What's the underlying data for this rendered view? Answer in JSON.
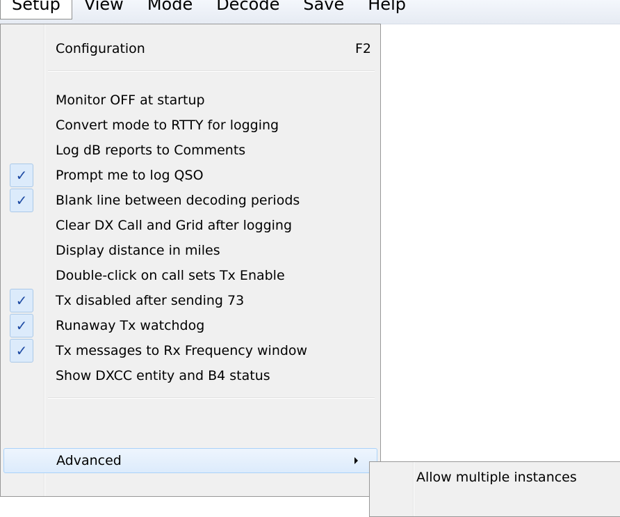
{
  "menubar": {
    "items": [
      "Setup",
      "View",
      "Mode",
      "Decode",
      "Save",
      "Help"
    ],
    "active": "Setup"
  },
  "setup_menu": {
    "configuration": {
      "label": "Configuration",
      "shortcut": "F2"
    },
    "items": [
      {
        "label": "Monitor OFF at startup",
        "checked": false
      },
      {
        "label": "Convert mode to RTTY for logging",
        "checked": false
      },
      {
        "label": "Log dB reports to Comments",
        "checked": false
      },
      {
        "label": "Prompt me to log QSO",
        "checked": true
      },
      {
        "label": "Blank line between decoding periods",
        "checked": true
      },
      {
        "label": "Clear DX Call and Grid after logging",
        "checked": false
      },
      {
        "label": "Display distance in miles",
        "checked": false
      },
      {
        "label": "Double-click on call sets Tx Enable",
        "checked": false
      },
      {
        "label": "Tx disabled after sending 73",
        "checked": true
      },
      {
        "label": "Runaway Tx watchdog",
        "checked": true
      },
      {
        "label": "Tx messages to Rx Frequency window",
        "checked": true
      },
      {
        "label": "Show DXCC entity and B4 status",
        "checked": false
      }
    ],
    "advanced": {
      "label": "Advanced",
      "has_submenu": true,
      "highlighted": true
    }
  },
  "advanced_submenu": {
    "items": [
      {
        "label": "Allow multiple instances"
      }
    ]
  },
  "icons": {
    "check": "✓",
    "submenu_arrow": "triangle-right"
  },
  "colors": {
    "menu_background": "#f0f0f0",
    "check_background": "#dcebfb",
    "check_color": "#1d4aa3",
    "highlight_border": "#a9d2f9"
  }
}
